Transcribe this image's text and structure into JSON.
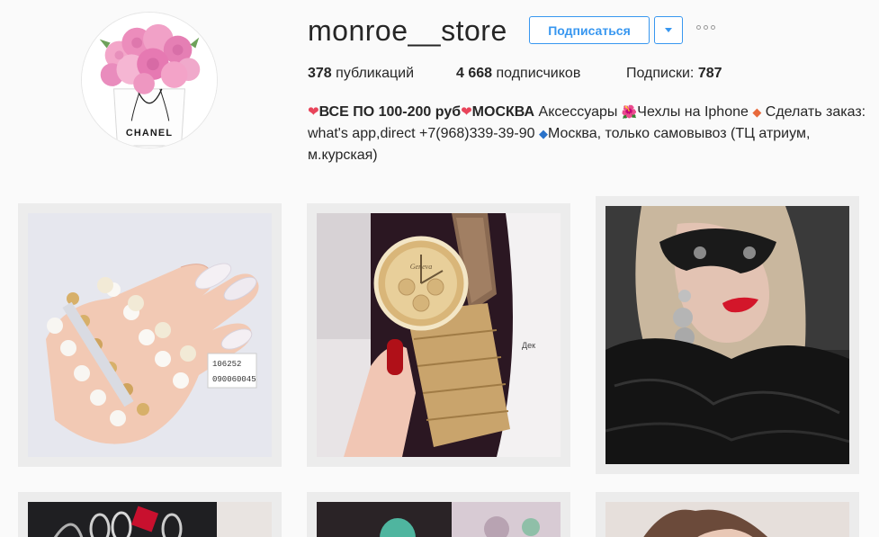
{
  "profile": {
    "username": "monroe__store",
    "follow_label": "Подписаться",
    "avatar_text": "CHANEL"
  },
  "stats": {
    "posts_count": "378",
    "posts_label": "публикаций",
    "followers_count": "4 668",
    "followers_label": "подписчиков",
    "following_label": "Подписки:",
    "following_count": "787"
  },
  "bio": {
    "heart": "❤",
    "headline_1": "ВСЕ ПО 100-200 руб",
    "headline_2": "МОСКВА",
    "text_1": " Аксессуары ",
    "flower": "🌺",
    "text_2": "Чехлы на Iphone ",
    "diamond_orange": "◆",
    "text_3": " Сделать заказ: what's app,direct +7(968)339-39-90 ",
    "diamond_blue": "◆",
    "text_4": "Москва, только самовывоз (ТЦ атриум, м.курская)"
  },
  "posts": {
    "post1_price_code": "106252",
    "post1_barcode": "090060045",
    "post2_brand": "Geneva",
    "post2_bg_text": "Дек"
  },
  "colors": {
    "accent": "#3897f0",
    "text": "#262626",
    "background": "#fafafa",
    "lip_red": "#d3162a"
  },
  "icons": [
    "chevron-down-icon",
    "more-options-icon"
  ]
}
